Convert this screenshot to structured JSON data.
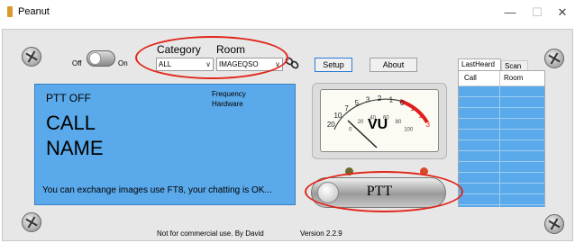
{
  "window": {
    "title": "Peanut",
    "minimize_label": "—",
    "maximize_label": "☐",
    "close_label": "✕"
  },
  "power": {
    "off_label": "Off",
    "on_label": "On"
  },
  "category": {
    "label": "Category",
    "value": "ALL"
  },
  "room": {
    "label": "Room",
    "value": "IMAGEQSO"
  },
  "buttons": {
    "setup": "Setup",
    "about": "About"
  },
  "display": {
    "status": "PTT OFF",
    "call": "CALL",
    "name": "NAME",
    "frequency_label": "Frequency",
    "hardware_label": "Hardware",
    "message": "You can exchange images use FT8, your chatting is OK..."
  },
  "vu_meter": {
    "label": "VU",
    "scale_labels": [
      "20",
      "10",
      "7",
      "5",
      "3",
      "2",
      "1",
      "0",
      "1",
      "2",
      "3"
    ],
    "inner_scale_labels": [
      "0",
      "20",
      "40",
      "60",
      "80",
      "100"
    ]
  },
  "ptt": {
    "label": "PTT"
  },
  "tabs": {
    "last_heard": "LastHeard",
    "scan": "Scan"
  },
  "list": {
    "columns": [
      "Call",
      "Room"
    ],
    "rows": []
  },
  "footer": {
    "notice": "Not for commercial use. By David",
    "version": "Version 2.2.9"
  },
  "colors": {
    "display_bg": "#5aa9ea",
    "list_highlight": "#5aa9ea",
    "annotation": "#e0261b",
    "led": "#d84a2a"
  }
}
